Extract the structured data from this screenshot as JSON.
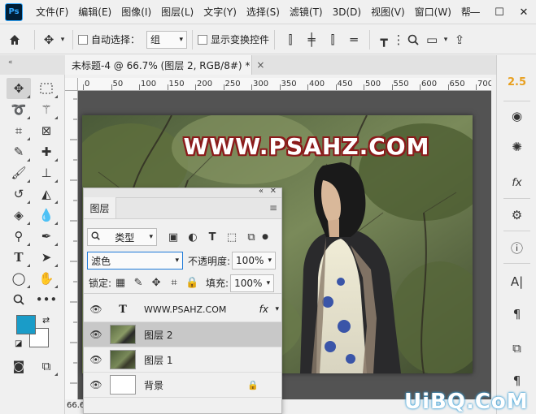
{
  "app": {
    "logo": "Ps"
  },
  "menu": [
    "文件(F)",
    "编辑(E)",
    "图像(I)",
    "图层(L)",
    "文字(Y)",
    "选择(S)",
    "滤镜(T)",
    "3D(D)",
    "视图(V)",
    "窗口(W)",
    "帮"
  ],
  "window_controls": {
    "minimize": "—",
    "maximize": "☐",
    "close": "✕"
  },
  "options_bar": {
    "auto_select_label": "自动选择：",
    "auto_select_value": "组",
    "show_transform_label": "显示变换控件"
  },
  "document": {
    "tab_title": "未标题-4 @ 66.7% (图层 2, RGB/8#) *",
    "close": "×",
    "zoom_status": "66.6"
  },
  "ruler_top": [
    "0",
    "50",
    "100",
    "150",
    "200",
    "250",
    "300",
    "350",
    "400",
    "450",
    "500",
    "550",
    "600",
    "650",
    "700"
  ],
  "canvas": {
    "watermark_text": "WWW.PSAHZ.COM"
  },
  "colors": {
    "foreground": "#1a9cc8",
    "background": "#ffffff",
    "accent": "#e8a020"
  },
  "layers_panel": {
    "tab": "图层",
    "filter_type": "类型",
    "blend_mode": "滤色",
    "opacity_label": "不透明度:",
    "opacity_value": "100%",
    "lock_label": "锁定:",
    "fill_label": "填充:",
    "fill_value": "100%",
    "layers": [
      {
        "name": "WWW.PSAHZ.COM",
        "kind": "text",
        "fx": "fx"
      },
      {
        "name": "图层 2",
        "kind": "image",
        "selected": true
      },
      {
        "name": "图层 1",
        "kind": "image"
      },
      {
        "name": "背景",
        "kind": "blank",
        "locked": true
      }
    ]
  },
  "right_panel": {
    "history_state": "2.5",
    "fx": "fx"
  },
  "site_watermark": "UiBQ.CoM"
}
